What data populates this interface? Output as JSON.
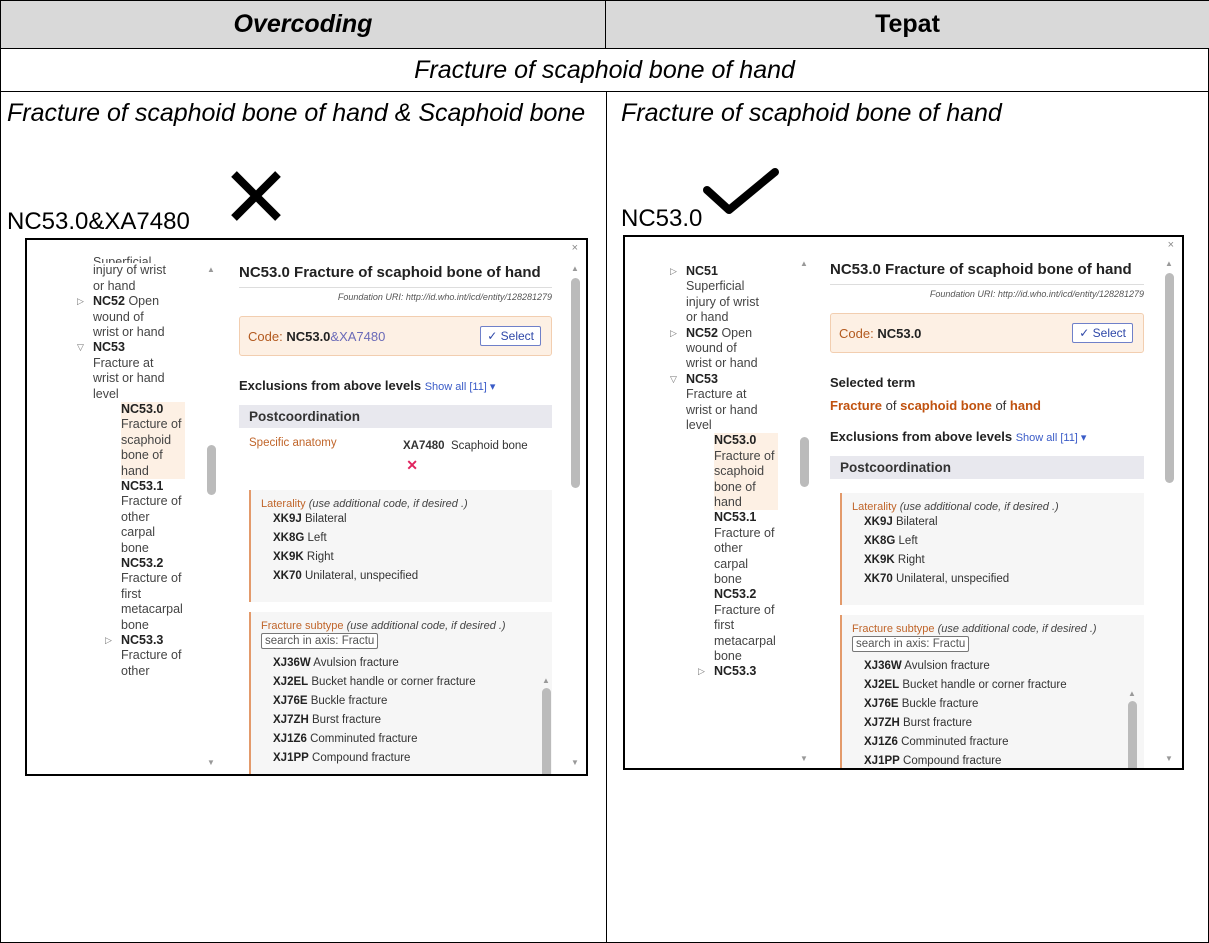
{
  "table": {
    "header_left": "Overcoding",
    "header_right": "Tepat",
    "condition": "Fracture of scaphoid bone of hand"
  },
  "left": {
    "title": "Fracture of scaphoid bone of hand & Scaphoid bone",
    "code": "NC53.0&XA7480",
    "verdict_icon": "cross-icon",
    "screenshot": {
      "tree": [
        {
          "text": "Superficial",
          "partial": true
        },
        {
          "text": "injury of wrist"
        },
        {
          "text": "or hand"
        },
        {
          "code": "NC52",
          "text": "Open"
        },
        {
          "text": "wound of"
        },
        {
          "text": "wrist or hand"
        },
        {
          "code": "NC53"
        },
        {
          "text": "Fracture at"
        },
        {
          "text": "wrist or hand"
        },
        {
          "text": "level"
        },
        {
          "code": "NC53.0"
        },
        {
          "text": "Fracture of"
        },
        {
          "text": "scaphoid"
        },
        {
          "text": "bone of"
        },
        {
          "text": "hand"
        },
        {
          "code": "NC53.1"
        },
        {
          "text": "Fracture of"
        },
        {
          "text": "other"
        },
        {
          "text": "carpal"
        },
        {
          "text": "bone"
        },
        {
          "code": "NC53.2"
        },
        {
          "text": "Fracture of"
        },
        {
          "text": "first"
        },
        {
          "text": "metacarpal"
        },
        {
          "text": "bone"
        },
        {
          "code": "NC53.3"
        },
        {
          "text": "Fracture of"
        },
        {
          "text": "other"
        }
      ],
      "title": "NC53.0 Fracture of scaphoid bone of hand",
      "uri": "Foundation URI: http://id.who.int/icd/entity/128281279",
      "code_label": "Code:",
      "code_main": "NC53.0",
      "code_ext": "&XA7480",
      "select": "✓ Select",
      "exclusions": "Exclusions from above levels",
      "show_all": "Show all [11] ▾",
      "postcoordination": "Postcoordination",
      "specific_anatomy": "Specific anatomy",
      "anatomy_code": "XA7480",
      "anatomy_text": "Scaphoid bone",
      "remove": "✕",
      "laterality": "Laterality",
      "use_additional": "(use additional code, if desired .)",
      "lat_items": [
        {
          "code": "XK9J",
          "text": "Bilateral"
        },
        {
          "code": "XK8G",
          "text": "Left"
        },
        {
          "code": "XK9K",
          "text": "Right"
        },
        {
          "code": "XK70",
          "text": "Unilateral, unspecified"
        }
      ],
      "fracture_subtype": "Fracture subtype",
      "search_placeholder": "search in axis: Fractu",
      "frac_items": [
        {
          "code": "XJ36W",
          "text": "Avulsion fracture"
        },
        {
          "code": "XJ2EL",
          "text": "Bucket handle or corner fracture"
        },
        {
          "code": "XJ76E",
          "text": "Buckle fracture"
        },
        {
          "code": "XJ7ZH",
          "text": "Burst fracture"
        },
        {
          "code": "XJ1Z6",
          "text": "Comminuted fracture"
        },
        {
          "code": "XJ1PP",
          "text": "Compound fracture"
        }
      ],
      "close": "×"
    }
  },
  "right": {
    "title": "Fracture of scaphoid bone of hand",
    "code": "NC53.0",
    "verdict_icon": "checkmark-icon",
    "screenshot": {
      "tree": [
        {
          "code": "NC51"
        },
        {
          "text": "Superficial"
        },
        {
          "text": "injury of wrist"
        },
        {
          "text": "or hand"
        },
        {
          "code": "NC52",
          "text": "Open"
        },
        {
          "text": "wound of"
        },
        {
          "text": "wrist or hand"
        },
        {
          "code": "NC53"
        },
        {
          "text": "Fracture at"
        },
        {
          "text": "wrist or hand"
        },
        {
          "text": "level"
        },
        {
          "code": "NC53.0"
        },
        {
          "text": "Fracture of"
        },
        {
          "text": "scaphoid"
        },
        {
          "text": "bone of"
        },
        {
          "text": "hand"
        },
        {
          "code": "NC53.1"
        },
        {
          "text": "Fracture of"
        },
        {
          "text": "other"
        },
        {
          "text": "carpal"
        },
        {
          "text": "bone"
        },
        {
          "code": "NC53.2"
        },
        {
          "text": "Fracture of"
        },
        {
          "text": "first"
        },
        {
          "text": "metacarpal"
        },
        {
          "text": "bone"
        },
        {
          "code": "NC53.3"
        }
      ],
      "title": "NC53.0 Fracture of scaphoid bone of hand",
      "uri": "Foundation URI: http://id.who.int/icd/entity/128281279",
      "code_label": "Code:",
      "code_main": "NC53.0",
      "select": "✓ Select",
      "selected_term": "Selected term",
      "term_parts": [
        "Fracture",
        " of ",
        "scaphoid bone",
        " of ",
        "hand"
      ],
      "exclusions": "Exclusions from above levels",
      "show_all": "Show all [11] ▾",
      "postcoordination": "Postcoordination",
      "laterality": "Laterality",
      "use_additional": "(use additional code, if desired .)",
      "lat_items": [
        {
          "code": "XK9J",
          "text": "Bilateral"
        },
        {
          "code": "XK8G",
          "text": "Left"
        },
        {
          "code": "XK9K",
          "text": "Right"
        },
        {
          "code": "XK70",
          "text": "Unilateral, unspecified"
        }
      ],
      "fracture_subtype": "Fracture subtype",
      "search_placeholder": "search in axis: Fractu",
      "frac_items": [
        {
          "code": "XJ36W",
          "text": "Avulsion fracture"
        },
        {
          "code": "XJ2EL",
          "text": "Bucket handle or corner fracture"
        },
        {
          "code": "XJ76E",
          "text": "Buckle fracture"
        },
        {
          "code": "XJ7ZH",
          "text": "Burst fracture"
        },
        {
          "code": "XJ1Z6",
          "text": "Comminuted fracture"
        },
        {
          "code": "XJ1PP",
          "text": "Compound fracture"
        }
      ],
      "close": "×"
    }
  }
}
